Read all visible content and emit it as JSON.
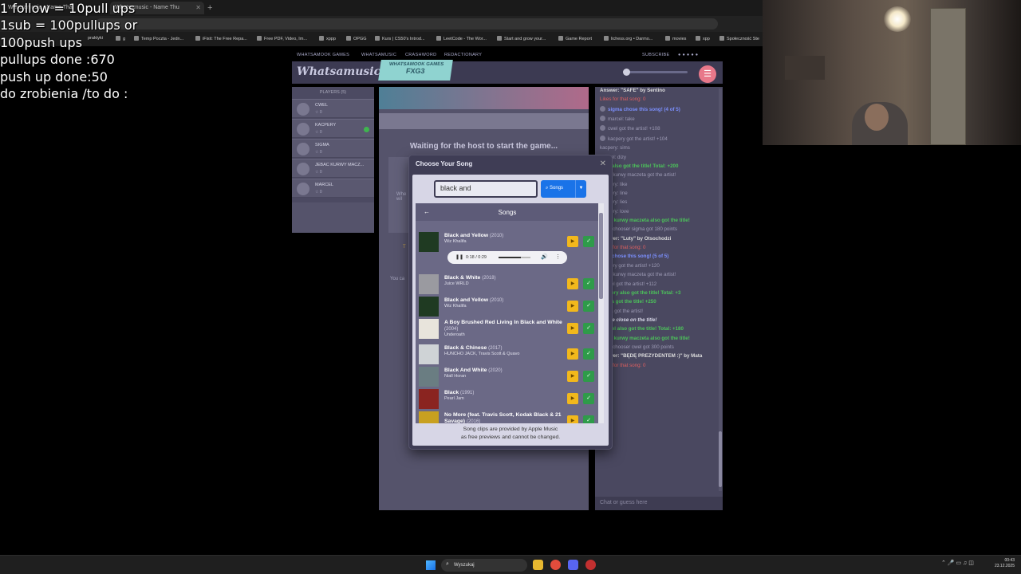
{
  "overlay": {
    "lines": [
      "1 follow = 10pull ups",
      "1sub = 100pullups or",
      "100push ups",
      "pullups done :670",
      "push up done:50",
      "do zrobienia /to do :"
    ]
  },
  "browser": {
    "tabs": [
      {
        "label": "Whatsamusic - Name That",
        "active": false
      },
      {
        "label": "Whatsamusic - Name Thu",
        "active": true
      }
    ],
    "bookmarks": [
      "praktyki",
      "g",
      "Temp Poczta - Jedn...",
      "iFixit: The Free Repa...",
      "Free PDF, Video, Im...",
      "xppp",
      "OPGG",
      "Kurs | CS50's Introd...",
      "LeetCode - The Wor...",
      "Start and grow your...",
      "Game Report",
      "lichess.org • Darmo...",
      "movies",
      "xpp",
      "Społeczność Ste"
    ]
  },
  "site": {
    "nav": [
      "WHATSAMOOK GAMES",
      "WHATSAMUSIC",
      "CRASHWORD",
      "REDACTIONARY"
    ],
    "nav_right": "SUBSCRIBE",
    "logo": "Whatsamusic",
    "badge_top": "WHATSAMOOK GAMES",
    "badge_code": "FXG3"
  },
  "players": {
    "title": "PLAYERS (5)",
    "list": [
      {
        "name": "CWEL",
        "score": "☆ 0",
        "ready": false
      },
      {
        "name": "KACPERY",
        "score": "☆ 0",
        "ready": true
      },
      {
        "name": "SIGMA",
        "score": "☆ 0",
        "ready": false
      },
      {
        "name": "JEBAC KURWY MACZ...",
        "score": "☆ 0",
        "ready": false
      },
      {
        "name": "MARCEL",
        "score": "☆ 0",
        "ready": false
      }
    ]
  },
  "center": {
    "waiting": "Waiting for the host to start the game...",
    "side1": "Whe",
    "side1b": "wil",
    "side2": "You ca",
    "side3": "T"
  },
  "modal": {
    "title": "Choose Your Song",
    "search_value": "black and",
    "search_button": "Songs",
    "panel_title": "Songs",
    "player_time": "0:18 / 0:29",
    "note_line1": "Song clips are provided by Apple Music",
    "note_line2": "as free previews and cannot be changed.",
    "songs": [
      {
        "title": "Black and Yellow",
        "year": "(2010)",
        "artist": "Wiz Khalifa",
        "art": "#1f3a22"
      },
      {
        "title": "Black & White",
        "year": "(2018)",
        "artist": "Juice WRLD",
        "art": "#9a9aa0"
      },
      {
        "title": "Black and Yellow",
        "year": "(2010)",
        "artist": "Wiz Khalifa",
        "art": "#1f3a22"
      },
      {
        "title": "A Boy Brushed Red Living In Black and White",
        "year": "(2004)",
        "artist": "Underoath",
        "art": "#e8e4dc"
      },
      {
        "title": "Black & Chinese",
        "year": "(2017)",
        "artist": "HUNCHO JACK, Travis Scott & Quavo",
        "art": "#cfd3d6"
      },
      {
        "title": "Black And White",
        "year": "(2020)",
        "artist": "Niall Horan",
        "art": "#6a7d82"
      },
      {
        "title": "Black",
        "year": "(1991)",
        "artist": "Pearl Jam",
        "art": "#8a2420"
      },
      {
        "title": "No More (feat. Travis Scott, Kodak Black & 21 Savage)",
        "year": "(2016)",
        "artist": "",
        "art": "#c8a020"
      }
    ]
  },
  "chat": {
    "messages": [
      {
        "text": "Answer: \"SAFE\" by Sentino",
        "style": "bold"
      },
      {
        "text": "Likes for that song: 0",
        "style": "red"
      },
      {
        "text": "sigma chose this song! (4 of 5)",
        "style": "blue",
        "dot": true
      },
      {
        "text": "marcel: take",
        "style": "plain",
        "dot": true
      },
      {
        "text": "cwel got the artist! +108",
        "style": "plain",
        "dot": true
      },
      {
        "text": "kacpery got the artist! +104",
        "style": "plain",
        "dot": true
      },
      {
        "text": "kacpery: sims",
        "style": "plain"
      },
      {
        "text": "marcel: dizy",
        "style": "plain"
      },
      {
        "text": "cwel also got the title! Total: +200",
        "style": "green"
      },
      {
        "text": "jebac kurwy maczeta got the artist!",
        "style": "plain"
      },
      {
        "text": "kacpery: like",
        "style": "plain"
      },
      {
        "text": "kacpery: line",
        "style": "plain"
      },
      {
        "text": "kacpery: lies",
        "style": "plain"
      },
      {
        "text": "kacpery: love",
        "style": "plain"
      },
      {
        "text": "jebac kurwy maczeta also got the title!",
        "style": "green"
      },
      {
        "text": "Song chooser sigma got 180 points",
        "style": "plain"
      },
      {
        "text": "Answer: \"Luty\" by Otsochodzi",
        "style": "bold"
      },
      {
        "text": "Likes for that song: 0",
        "style": "red"
      },
      {
        "text": "cwel chose this song! (5 of 5)",
        "style": "blue"
      },
      {
        "text": "kacpery got the artist! +120",
        "style": "plain"
      },
      {
        "text": "jebac kurwy maczeta got the artist!",
        "style": "plain"
      },
      {
        "text": "marcel got the artist! +112",
        "style": "plain"
      },
      {
        "text": "kacpery also got the title! Total: +3",
        "style": "green"
      },
      {
        "text": "sigma got the title! +250",
        "style": "green"
      },
      {
        "text": "sigma got the artist!",
        "style": "plain"
      },
      {
        "text": "You're close on the title!",
        "style": "em"
      },
      {
        "text": "marcel also got the title! Total: +180",
        "style": "green"
      },
      {
        "text": "jebac kurwy maczeta also got the title!",
        "style": "green"
      },
      {
        "text": "Song chooser cwel got 300 points",
        "style": "plain"
      },
      {
        "text": "Answer: \"BĘDĘ PREZYDENTEM :)\" by Mata",
        "style": "bold"
      },
      {
        "text": "Likes for that song: 0",
        "style": "red"
      }
    ],
    "input_placeholder": "Chat or guess here"
  },
  "taskbar": {
    "search": "Wyszukaj",
    "time": "00:43",
    "date": "23.12.2025"
  },
  "colors": {
    "modal_bg": "#3f3d55",
    "search_button": "#1a73e8",
    "play_button": "#f2b81c",
    "select_button": "#2f9b4a",
    "chat_green": "#4cc55a",
    "chat_blue": "#7c90ff",
    "chat_red": "#e06060"
  }
}
